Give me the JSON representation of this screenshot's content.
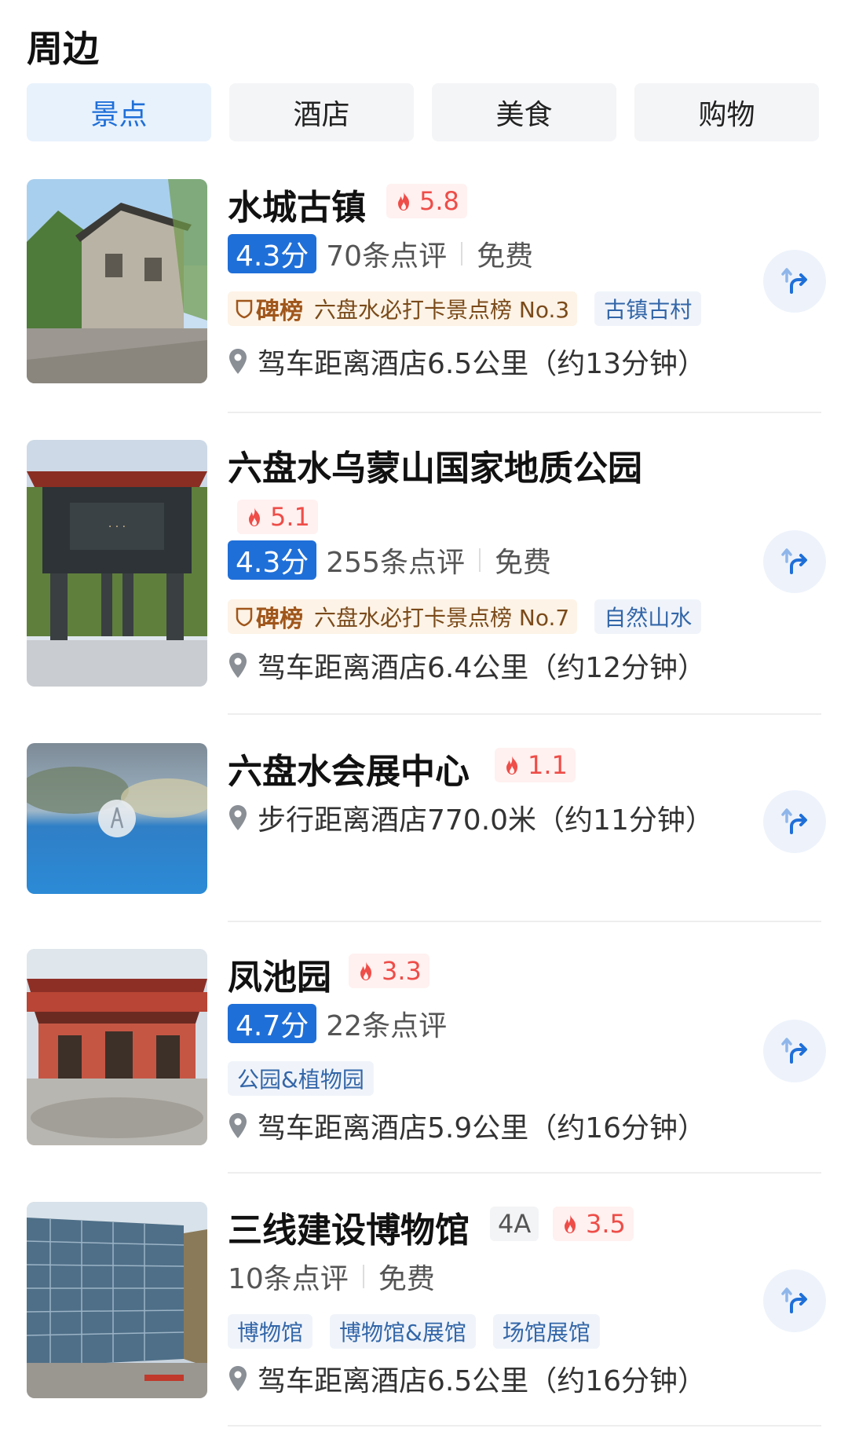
{
  "section_title": "周边",
  "tabs": [
    {
      "label": "景点",
      "active": true
    },
    {
      "label": "酒店",
      "active": false
    },
    {
      "label": "美食",
      "active": false
    },
    {
      "label": "购物",
      "active": false
    }
  ],
  "accent_color": "#1f6fd8",
  "heat_color": "#ee4d48",
  "items": [
    {
      "name": "水城古镇",
      "heat": "5.8",
      "score": "4.3分",
      "reviews": "70条点评",
      "price": "免费",
      "rank_brand": "碑榜",
      "rank_text": "六盘水必打卡景点榜 No.3",
      "tags": [
        "古镇古村"
      ],
      "distance": "驾车距离酒店6.5公里（约13分钟）",
      "route_icon": "route-arrow-icon"
    },
    {
      "name": "六盘水乌蒙山国家地质公园",
      "heat": "5.1",
      "score": "4.3分",
      "reviews": "255条点评",
      "price": "免费",
      "rank_brand": "碑榜",
      "rank_text": "六盘水必打卡景点榜 No.7",
      "tags": [
        "自然山水"
      ],
      "distance": "驾车距离酒店6.4公里（约12分钟）",
      "route_icon": "route-arrow-icon"
    },
    {
      "name": "六盘水会展中心",
      "heat": "1.1",
      "distance": "步行距离酒店770.0米（约11分钟）",
      "route_icon": "route-arrow-icon"
    },
    {
      "name": "凤池园",
      "heat": "3.3",
      "score": "4.7分",
      "reviews": "22条点评",
      "tags": [
        "公园&植物园"
      ],
      "distance": "驾车距离酒店5.9公里（约16分钟）",
      "route_icon": "route-arrow-icon"
    },
    {
      "name": "三线建设博物馆",
      "grade": "4A",
      "heat": "3.5",
      "reviews": "10条点评",
      "price": "免费",
      "tags": [
        "博物馆",
        "博物馆&展馆",
        "场馆展馆"
      ],
      "distance": "驾车距离酒店6.5公里（约16分钟）",
      "route_icon": "route-arrow-icon"
    }
  ]
}
